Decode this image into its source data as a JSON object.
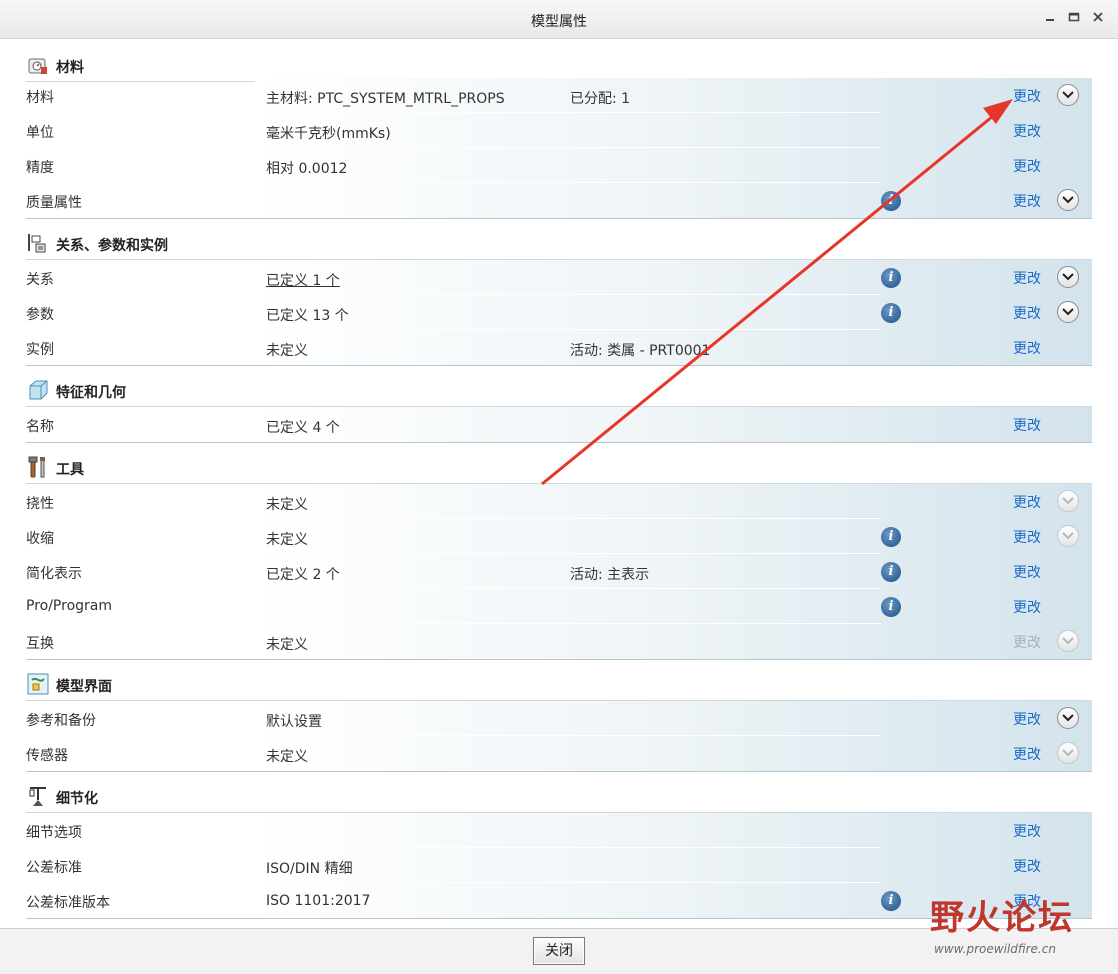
{
  "window": {
    "title": "模型属性",
    "minimize_label": "▬",
    "maximize_label": "▢",
    "close_label": "✕"
  },
  "colors": {
    "link": "#1a6bc6",
    "arrow": "#e8352a",
    "watermark": "#c0362c"
  },
  "sections": {
    "material": {
      "title": "材料",
      "icon": "material-scale-icon",
      "rows": [
        {
          "label": "材料",
          "value": "主材料: PTC_SYSTEM_MTRL_PROPS",
          "value2": "已分配: 1",
          "change": "更改"
        },
        {
          "label": "单位",
          "value": "毫米千克秒(mmKs)",
          "change": "更改"
        },
        {
          "label": "精度",
          "value": "相对 0.0012",
          "change": "更改"
        },
        {
          "label": "质量属性",
          "change": "更改"
        }
      ]
    },
    "relations": {
      "title": "关系、参数和实例",
      "icon": "relations-params-icon",
      "rows": [
        {
          "label": "关系",
          "value": "已定义 1 个",
          "change": "更改"
        },
        {
          "label": "参数",
          "value": "已定义 13 个",
          "change": "更改"
        },
        {
          "label": "实例",
          "value": "未定义",
          "value2": "活动: 类属 - PRT0001",
          "change": "更改"
        }
      ]
    },
    "features": {
      "title": "特征和几何",
      "icon": "feature-geometry-icon",
      "rows": [
        {
          "label": "名称",
          "value": "已定义 4 个",
          "change": "更改"
        }
      ]
    },
    "tools": {
      "title": "工具",
      "icon": "tools-icon",
      "rows": [
        {
          "label": "挠性",
          "value": "未定义",
          "change": "更改"
        },
        {
          "label": "收缩",
          "value": "未定义",
          "change": "更改"
        },
        {
          "label": "简化表示",
          "value": "已定义 2 个",
          "value2": "活动: 主表示",
          "change": "更改"
        },
        {
          "label": "Pro/Program",
          "change": "更改"
        },
        {
          "label": "互换",
          "value": "未定义",
          "change": "更改"
        }
      ]
    },
    "interface": {
      "title": "模型界面",
      "icon": "model-interface-icon",
      "rows": [
        {
          "label": "参考和备份",
          "value": "默认设置",
          "change": "更改"
        },
        {
          "label": "传感器",
          "value": "未定义",
          "change": "更改"
        }
      ]
    },
    "detailing": {
      "title": "细节化",
      "icon": "detailing-icon",
      "rows": [
        {
          "label": "细节选项",
          "change": "更改"
        },
        {
          "label": "公差标准",
          "value": "ISO/DIN 精细",
          "change": "更改"
        },
        {
          "label": "公差标准版本",
          "value": "ISO 1101:2017",
          "change": "更改"
        }
      ]
    }
  },
  "info_icon_glyph": "i",
  "footer": {
    "close_label": "关闭"
  },
  "watermark": {
    "main": "野火论坛",
    "url": "www.proewildfire.cn"
  }
}
